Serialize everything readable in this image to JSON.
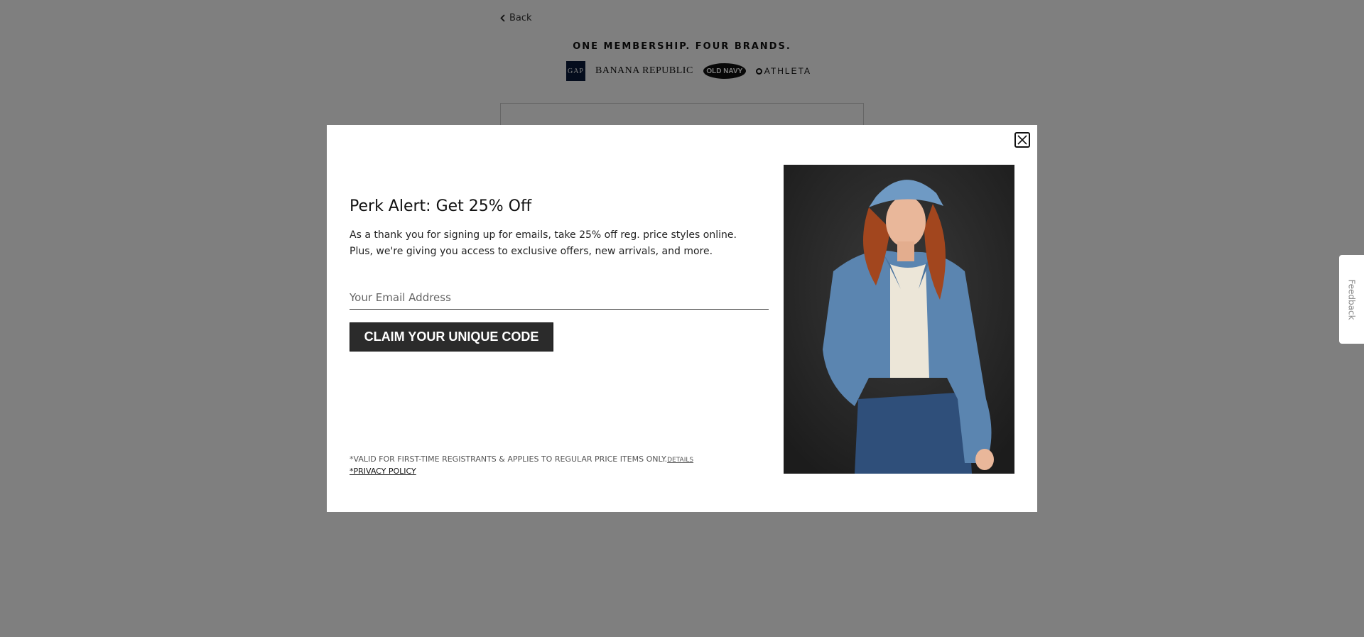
{
  "page": {
    "back_label": "Back",
    "tagline": "ONE MEMBERSHIP. FOUR BRANDS.",
    "brands": {
      "gap": "GAP",
      "banana_republic": "BANANA REPUBLIC",
      "old_navy": "OLD NAVY",
      "athleta": "ATHLETA"
    }
  },
  "modal": {
    "headline": "Perk Alert: Get 25% Off",
    "body": "As a thank you for signing up for emails, take 25% off reg. price styles online. Plus, we're giving you access to exclusive offers, new arrivals, and more.",
    "email_placeholder": "Your Email Address",
    "email_value": "",
    "cta_label": "CLAIM YOUR UNIQUE CODE",
    "legal_text": "*VALID FOR FIRST-TIME REGISTRANTS & APPLIES TO REGULAR PRICE ITEMS ONLY.",
    "details_label": "DETAILS",
    "privacy_label": "*PRIVACY POLICY"
  },
  "feedback_label": "Feedback",
  "colors": {
    "overlay": "#808080",
    "button_bg": "#2b2b2b",
    "denim": "#5b85b0"
  },
  "icons": {
    "back": "chevron-left-icon",
    "close": "close-icon"
  }
}
